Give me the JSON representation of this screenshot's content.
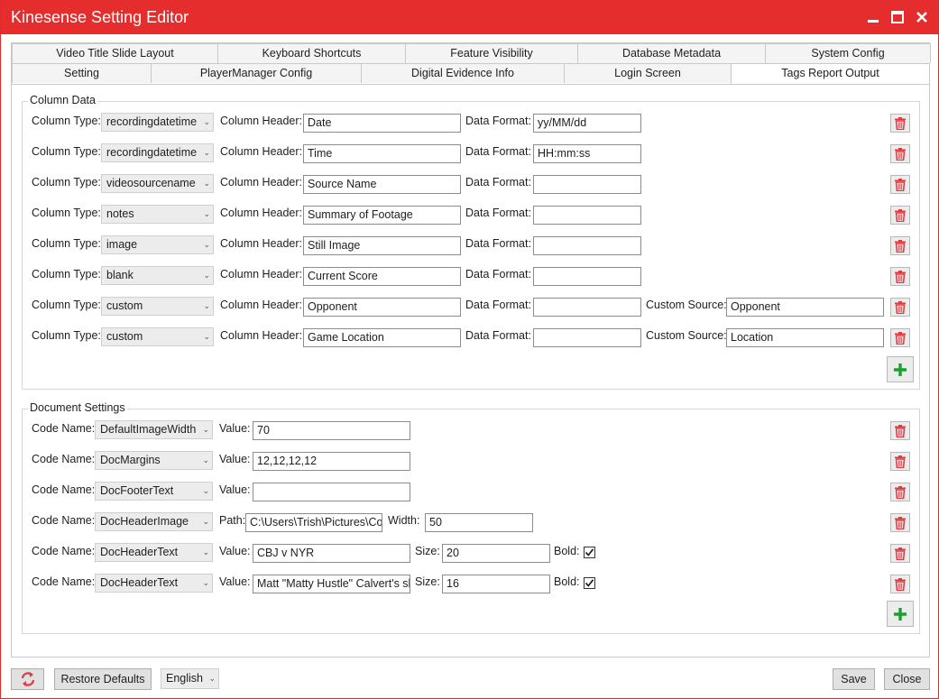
{
  "window": {
    "title": "Kinesense Setting Editor"
  },
  "tabs": {
    "row1": [
      "Video Title Slide Layout",
      "Keyboard Shortcuts",
      "Feature Visibility",
      "Database Metadata",
      "System Config"
    ],
    "row2": [
      "Setting",
      "PlayerManager Config",
      "Digital Evidence Info",
      "Login Screen",
      "Tags Report Output"
    ],
    "active": "Tags Report Output"
  },
  "column_data": {
    "title": "Column Data",
    "labels": {
      "type": "Column Type:",
      "header": "Column Header:",
      "format": "Data Format:",
      "custom_source": "Custom Source:"
    },
    "rows": [
      {
        "type": "recordingdatetime",
        "header": "Date",
        "format": "yy/MM/dd",
        "custom_source": null
      },
      {
        "type": "recordingdatetime",
        "header": "Time",
        "format": "HH:mm:ss",
        "custom_source": null
      },
      {
        "type": "videosourcename",
        "header": "Source Name",
        "format": "",
        "custom_source": null
      },
      {
        "type": "notes",
        "header": "Summary of Footage",
        "format": "",
        "custom_source": null
      },
      {
        "type": "image",
        "header": "Still Image",
        "format": "",
        "custom_source": null
      },
      {
        "type": "blank",
        "header": "Current Score",
        "format": "",
        "custom_source": null
      },
      {
        "type": "custom",
        "header": "Opponent",
        "format": "",
        "custom_source": "Opponent"
      },
      {
        "type": "custom",
        "header": "Game Location",
        "format": "",
        "custom_source": "Location"
      }
    ]
  },
  "document_settings": {
    "title": "Document Settings",
    "labels": {
      "code_name": "Code Name:",
      "value": "Value:",
      "path": "Path:",
      "width": "Width:",
      "size": "Size:",
      "bold": "Bold:"
    },
    "rows": [
      {
        "code": "DefaultImageWidth",
        "kind": "value",
        "value": "70"
      },
      {
        "code": "DocMargins",
        "kind": "value",
        "value": "12,12,12,12"
      },
      {
        "code": "DocFooterText",
        "kind": "value",
        "value": ""
      },
      {
        "code": "DocHeaderImage",
        "kind": "path",
        "path": "C:\\Users\\Trish\\Pictures\\Colo",
        "width": "50"
      },
      {
        "code": "DocHeaderText",
        "kind": "text",
        "value": "CBJ v NYR",
        "size": "20",
        "bold": true
      },
      {
        "code": "DocHeaderText",
        "kind": "text",
        "value": "Matt \"Matty Hustle\" Calvert's sh",
        "size": "16",
        "bold": true
      }
    ]
  },
  "footer": {
    "restore_label": "Restore Defaults",
    "language": "English",
    "save_label": "Save",
    "close_label": "Close"
  },
  "icons": {
    "delete": "trash-icon",
    "add": "plus-icon",
    "reset": "refresh-arrows-icon",
    "dropdown": "chevron-down-icon"
  },
  "colors": {
    "title_bar": "#e52d2d",
    "delete_icon": "#e0393e",
    "add_icon": "#1aa22e"
  }
}
